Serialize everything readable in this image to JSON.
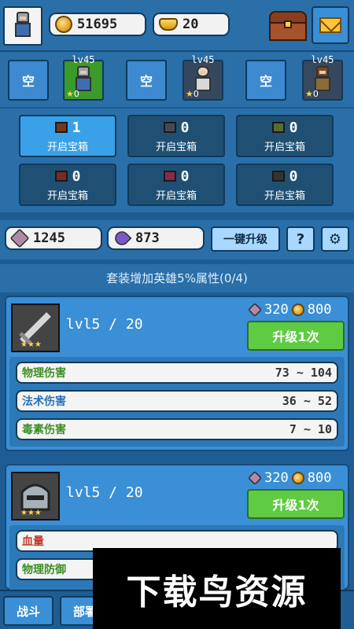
{
  "top": {
    "gold": "51695",
    "ingots": "20"
  },
  "slots": [
    {
      "type": "empty",
      "label": "空"
    },
    {
      "type": "hero",
      "level": "lv45",
      "stars": "0",
      "color": "green"
    },
    {
      "type": "empty",
      "label": "空"
    },
    {
      "type": "hero",
      "level": "lv45",
      "stars": "0",
      "color": "dark"
    },
    {
      "type": "empty",
      "label": "空"
    },
    {
      "type": "hero",
      "level": "lv45",
      "stars": "0",
      "color": "dark"
    }
  ],
  "chests": [
    {
      "count": "1",
      "label": "开启宝箱",
      "color": "#6e3a1e"
    },
    {
      "count": "0",
      "label": "开启宝箱",
      "color": "#444a55"
    },
    {
      "count": "0",
      "label": "开启宝箱",
      "color": "#556b3a"
    },
    {
      "count": "0",
      "label": "开启宝箱",
      "color": "#7a2a2a"
    },
    {
      "count": "0",
      "label": "开启宝箱",
      "color": "#8a2a4a"
    },
    {
      "count": "0",
      "label": "开启宝箱",
      "color": "#333333"
    }
  ],
  "resources": {
    "stone": "1245",
    "crystal": "873",
    "upgrade_all": "一键升级",
    "help": "?",
    "settings": "⚙"
  },
  "set_bonus": "套装增加英雄5%属性(0/4)",
  "equipment": [
    {
      "name": "sword",
      "level": "lvl5 / 20",
      "cost_stone": "320",
      "cost_gold": "800",
      "upgrade": "升级1次",
      "stats": [
        {
          "label": "物理伤害",
          "value": "73 ~ 104",
          "color": "#3b8d22"
        },
        {
          "label": "法术伤害",
          "value": "36 ~ 52",
          "color": "#2a6fb8"
        },
        {
          "label": "毒素伤害",
          "value": "7 ~ 10",
          "color": "#3b8d22"
        }
      ]
    },
    {
      "name": "helmet",
      "level": "lvl5 / 20",
      "cost_stone": "320",
      "cost_gold": "800",
      "upgrade": "升级1次",
      "stats": [
        {
          "label": "血量",
          "value": "",
          "color": "#c0392b"
        },
        {
          "label": "物理防御",
          "value": "",
          "color": "#3b8d22"
        }
      ]
    }
  ],
  "nav": [
    "战斗",
    "部署"
  ],
  "watermark": "下载鸟资源"
}
